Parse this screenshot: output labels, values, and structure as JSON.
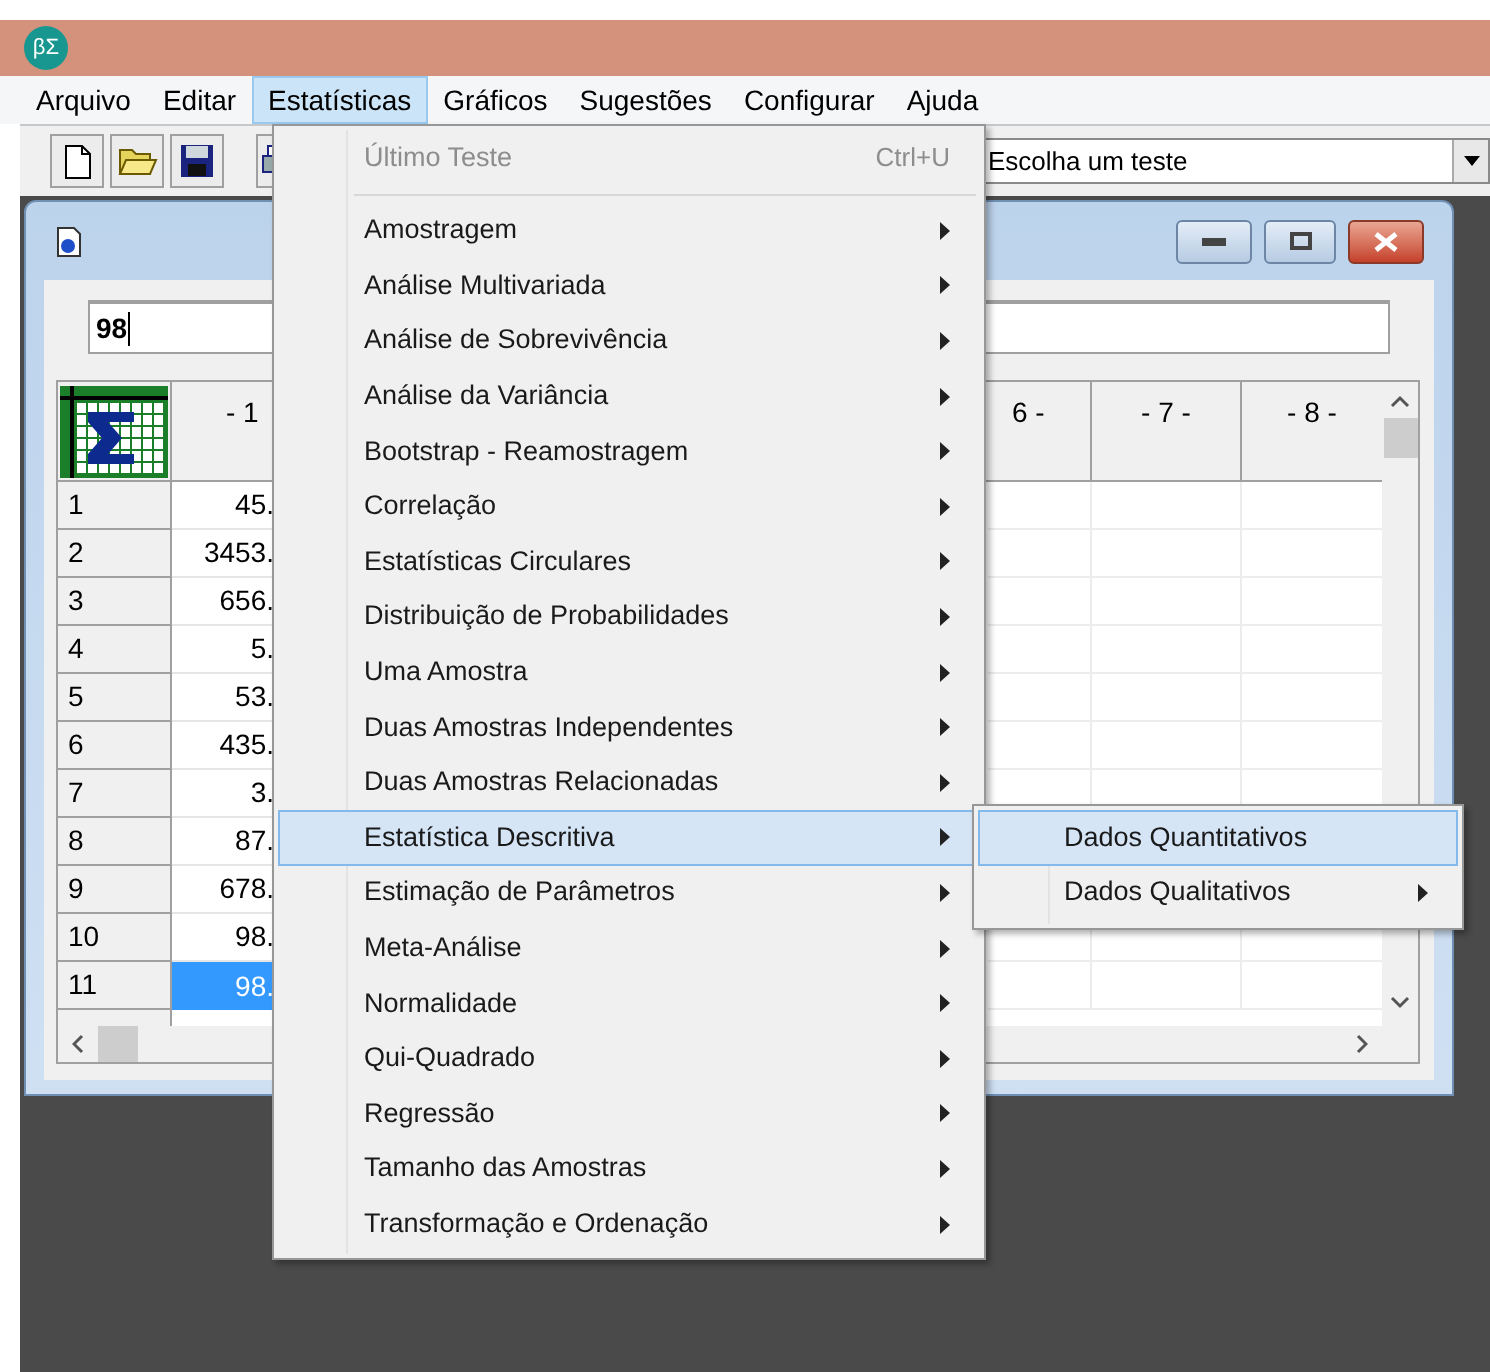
{
  "app": {
    "logo": "βΣ"
  },
  "menu_bar": [
    {
      "label": "Arquivo",
      "selected": false
    },
    {
      "label": "Editar",
      "selected": false
    },
    {
      "label": "Estatísticas",
      "selected": true
    },
    {
      "label": "Gráficos",
      "selected": false
    },
    {
      "label": "Sugestões",
      "selected": false
    },
    {
      "label": "Configurar",
      "selected": false
    },
    {
      "label": "Ajuda",
      "selected": false
    }
  ],
  "test_select": {
    "value": "Escolha um teste"
  },
  "data_window": {
    "input_value": "98",
    "columns": [
      "- 1",
      "6 -",
      "- 7 -",
      "- 8 -"
    ],
    "rows": [
      {
        "label": "1",
        "value": "45.",
        "selected": false
      },
      {
        "label": "2",
        "value": "3453.",
        "selected": false
      },
      {
        "label": "3",
        "value": "656.",
        "selected": false
      },
      {
        "label": "4",
        "value": "5.",
        "selected": false
      },
      {
        "label": "5",
        "value": "53.",
        "selected": false
      },
      {
        "label": "6",
        "value": "435.",
        "selected": false
      },
      {
        "label": "7",
        "value": "3.",
        "selected": false
      },
      {
        "label": "8",
        "value": "87.",
        "selected": false
      },
      {
        "label": "9",
        "value": "678.",
        "selected": false
      },
      {
        "label": "10",
        "value": "98.",
        "selected": false
      },
      {
        "label": "11",
        "value": "98.",
        "selected": true
      }
    ]
  },
  "statistics_menu": [
    {
      "kind": "command",
      "label": "Último Teste",
      "shortcut": "Ctrl+U",
      "disabled": true,
      "selected": false
    },
    {
      "kind": "separator"
    },
    {
      "kind": "submenu",
      "label": "Amostragem",
      "disabled": false,
      "selected": false
    },
    {
      "kind": "submenu",
      "label": "Análise Multivariada",
      "disabled": false,
      "selected": false
    },
    {
      "kind": "submenu",
      "label": "Análise de Sobrevivência",
      "disabled": false,
      "selected": false
    },
    {
      "kind": "submenu",
      "label": "Análise da Variância",
      "disabled": false,
      "selected": false
    },
    {
      "kind": "submenu",
      "label": "Bootstrap - Reamostragem",
      "disabled": false,
      "selected": false
    },
    {
      "kind": "submenu",
      "label": "Correlação",
      "disabled": false,
      "selected": false
    },
    {
      "kind": "submenu",
      "label": "Estatísticas Circulares",
      "disabled": false,
      "selected": false
    },
    {
      "kind": "submenu",
      "label": "Distribuição de Probabilidades",
      "disabled": false,
      "selected": false
    },
    {
      "kind": "submenu",
      "label": "Uma Amostra",
      "disabled": false,
      "selected": false
    },
    {
      "kind": "submenu",
      "label": "Duas Amostras Independentes",
      "disabled": false,
      "selected": false
    },
    {
      "kind": "submenu",
      "label": "Duas Amostras Relacionadas",
      "disabled": false,
      "selected": false
    },
    {
      "kind": "submenu",
      "label": "Estatística Descritiva",
      "disabled": false,
      "selected": true
    },
    {
      "kind": "submenu",
      "label": "Estimação de Parâmetros",
      "disabled": false,
      "selected": false
    },
    {
      "kind": "submenu",
      "label": "Meta-Análise",
      "disabled": false,
      "selected": false
    },
    {
      "kind": "submenu",
      "label": "Normalidade",
      "disabled": false,
      "selected": false
    },
    {
      "kind": "submenu",
      "label": "Qui-Quadrado",
      "disabled": false,
      "selected": false
    },
    {
      "kind": "submenu",
      "label": "Regressão",
      "disabled": false,
      "selected": false
    },
    {
      "kind": "submenu",
      "label": "Tamanho das Amostras",
      "disabled": false,
      "selected": false
    },
    {
      "kind": "submenu",
      "label": "Transformação e Ordenação",
      "disabled": false,
      "selected": false
    }
  ],
  "descriptive_submenu": [
    {
      "kind": "command",
      "label": "Dados Quantitativos",
      "selected": true
    },
    {
      "kind": "submenu",
      "label": "Dados Qualitativos",
      "selected": false
    }
  ]
}
